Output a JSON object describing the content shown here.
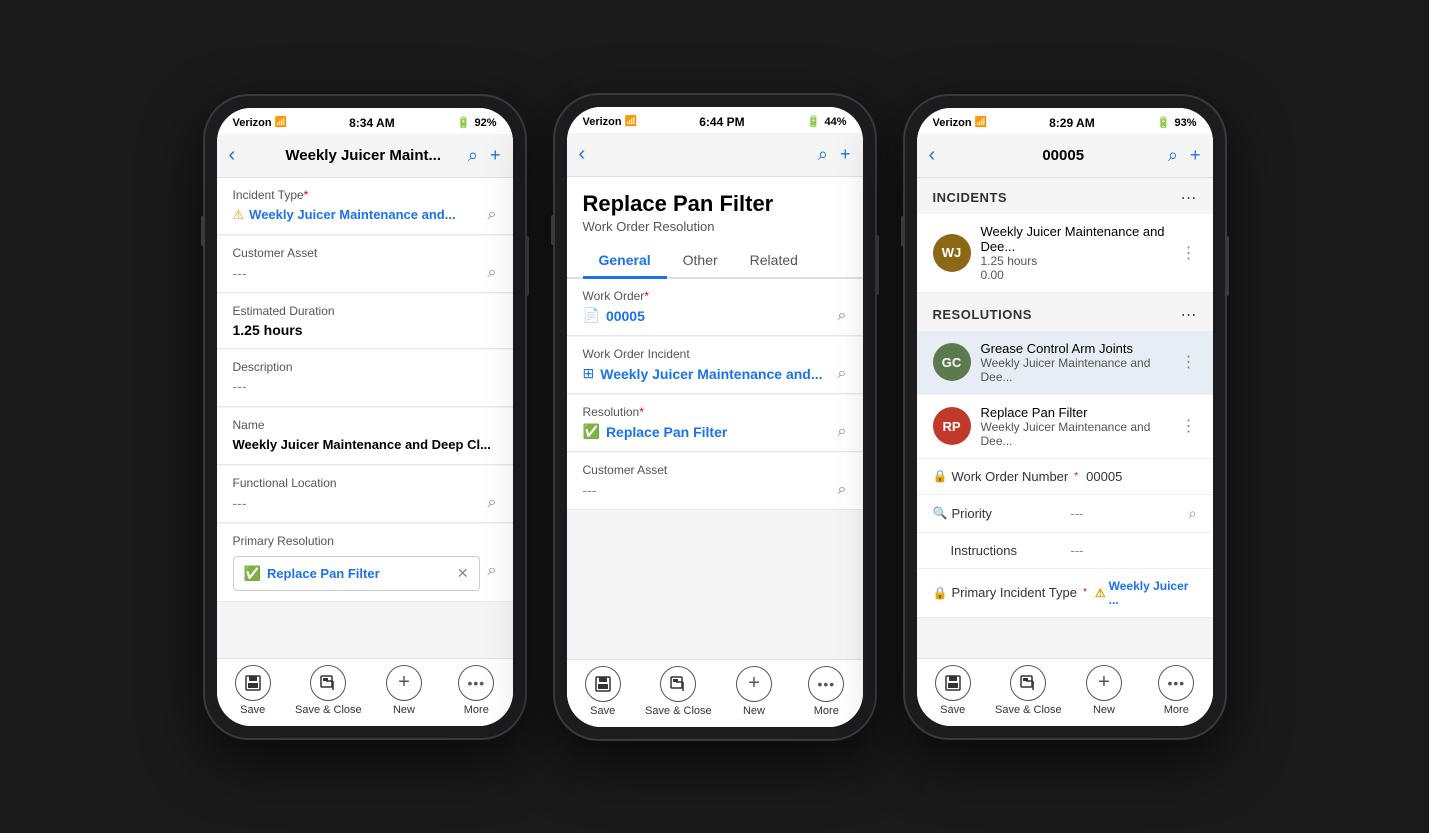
{
  "phone1": {
    "status": {
      "carrier": "Verizon",
      "time": "8:34 AM",
      "battery": "92%"
    },
    "nav": {
      "title": "Weekly Juicer Maint...",
      "back_label": "‹",
      "search_label": "⌕",
      "add_label": "+"
    },
    "fields": [
      {
        "label": "Incident Type",
        "required": true,
        "value": "Weekly Juicer Maintenance and...",
        "type": "link",
        "has_warning": true,
        "has_search": true
      },
      {
        "label": "Customer Asset",
        "required": false,
        "value": "---",
        "type": "muted",
        "has_search": true
      },
      {
        "label": "Estimated Duration",
        "required": false,
        "value": "1.25 hours",
        "type": "normal",
        "has_search": false
      },
      {
        "label": "Description",
        "required": false,
        "value": "---",
        "type": "muted",
        "has_search": false
      },
      {
        "label": "Name",
        "required": false,
        "value": "Weekly Juicer Maintenance and Deep Cl...",
        "type": "bold",
        "has_search": false
      },
      {
        "label": "Functional Location",
        "required": false,
        "value": "---",
        "type": "muted",
        "has_search": true
      },
      {
        "label": "Primary Resolution",
        "required": false,
        "value": "Replace Pan Filter",
        "type": "resolution",
        "has_search": true
      }
    ],
    "toolbar": {
      "items": [
        {
          "icon": "💾",
          "label": "Save"
        },
        {
          "icon": "🗓",
          "label": "Save & Close"
        },
        {
          "icon": "+",
          "label": "New"
        },
        {
          "icon": "•••",
          "label": "More"
        }
      ]
    }
  },
  "phone2": {
    "status": {
      "carrier": "Verizon",
      "time": "6:44 PM",
      "battery": "44%"
    },
    "nav": {
      "back_label": "‹",
      "search_label": "⌕",
      "add_label": "+"
    },
    "page": {
      "title": "Replace Pan Filter",
      "subtitle": "Work Order Resolution"
    },
    "tabs": [
      {
        "label": "General",
        "active": true
      },
      {
        "label": "Other",
        "active": false
      },
      {
        "label": "Related",
        "active": false
      }
    ],
    "fields": [
      {
        "label": "Work Order",
        "required": true,
        "value": "00005",
        "type": "link",
        "has_doc_icon": true,
        "has_search": true
      },
      {
        "label": "Work Order Incident",
        "required": false,
        "value": "Weekly Juicer Maintenance and...",
        "type": "link",
        "has_grid_icon": true,
        "has_search": true
      },
      {
        "label": "Resolution",
        "required": true,
        "value": "Replace Pan Filter",
        "type": "link",
        "has_check_icon": true,
        "has_search": true
      },
      {
        "label": "Customer Asset",
        "required": false,
        "value": "---",
        "type": "muted",
        "has_search": true
      }
    ],
    "toolbar": {
      "items": [
        {
          "icon": "💾",
          "label": "Save"
        },
        {
          "icon": "🗓",
          "label": "Save & Close"
        },
        {
          "icon": "+",
          "label": "New"
        },
        {
          "icon": "•••",
          "label": "More"
        }
      ]
    }
  },
  "phone3": {
    "status": {
      "carrier": "Verizon",
      "time": "8:29 AM",
      "battery": "93%"
    },
    "nav": {
      "title": "00005",
      "back_label": "‹",
      "search_label": "⌕",
      "add_label": "+"
    },
    "sections": [
      {
        "title": "INCIDENTS",
        "items": [
          {
            "avatar_text": "WJ",
            "avatar_class": "wj",
            "name": "Weekly Juicer Maintenance and Dee...",
            "sub1": "1.25 hours",
            "sub2": "0.00",
            "highlighted": false
          }
        ]
      },
      {
        "title": "RESOLUTIONS",
        "items": [
          {
            "avatar_text": "GC",
            "avatar_class": "gc",
            "name": "Grease Control Arm Joints",
            "sub1": "Weekly Juicer Maintenance and Dee...",
            "highlighted": true
          },
          {
            "avatar_text": "RP",
            "avatar_class": "rp",
            "name": "Replace Pan Filter",
            "sub1": "Weekly Juicer Maintenance and Dee...",
            "highlighted": false
          }
        ]
      }
    ],
    "info_fields": [
      {
        "icon": "lock",
        "label": "Work Order Number",
        "required": true,
        "value": "00005",
        "type": "normal",
        "has_search": false
      },
      {
        "icon": "search",
        "label": "Priority",
        "required": false,
        "value": "---",
        "type": "muted",
        "has_search": true
      },
      {
        "icon": "none",
        "label": "Instructions",
        "required": false,
        "value": "---",
        "type": "muted",
        "has_search": false
      },
      {
        "icon": "lock",
        "label": "Primary Incident Type",
        "required": true,
        "value": "Weekly Juicer ...",
        "type": "link",
        "has_warning": true,
        "has_search": false
      }
    ],
    "toolbar": {
      "items": [
        {
          "icon": "💾",
          "label": "Save"
        },
        {
          "icon": "🗓",
          "label": "Save & Close"
        },
        {
          "icon": "+",
          "label": "New"
        },
        {
          "icon": "•••",
          "label": "More"
        }
      ]
    }
  }
}
